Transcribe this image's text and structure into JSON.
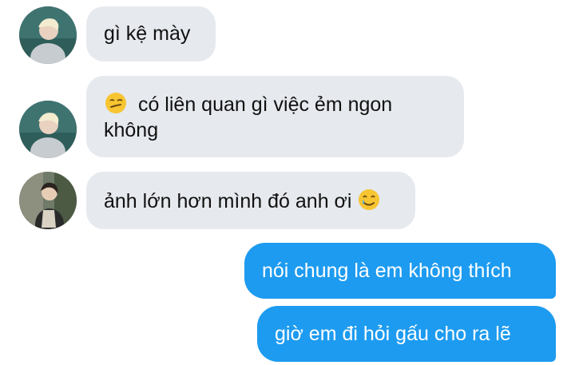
{
  "messages": [
    {
      "sender": "contact_a",
      "direction": "incoming",
      "text": "gì kệ mày"
    },
    {
      "sender": "contact_a",
      "direction": "incoming",
      "emoji": "smirking-face-emoji",
      "text_line1": "có liên quan gì việc ẻm ngon",
      "text_line2": "không"
    },
    {
      "sender": "contact_b",
      "direction": "incoming",
      "text": "ảnh lớn hơn mình đó anh ơi",
      "emoji": "smiling-face-with-tear-emoji"
    },
    {
      "sender": "me",
      "direction": "outgoing",
      "text": "nói chung là em không thích"
    },
    {
      "sender": "me",
      "direction": "outgoing",
      "text": "giờ em đi hỏi gấu cho ra lẽ"
    }
  ],
  "colors": {
    "incoming_bubble": "#e6e9ee",
    "outgoing_bubble": "#1d9bf0",
    "incoming_text": "#111111",
    "outgoing_text": "#ffffff"
  }
}
